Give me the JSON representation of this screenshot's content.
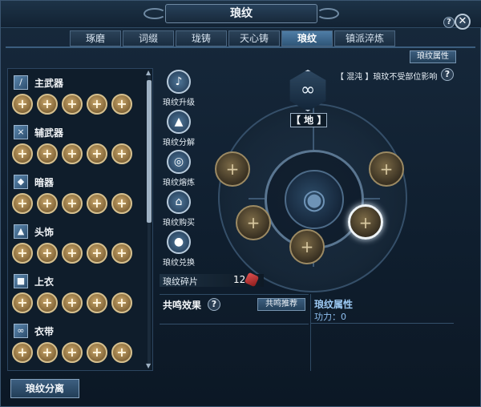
{
  "window": {
    "title": "琅纹"
  },
  "tabs": [
    {
      "label": "琢磨",
      "active": false
    },
    {
      "label": "词缀",
      "active": false
    },
    {
      "label": "珑铸",
      "active": false
    },
    {
      "label": "天心铸",
      "active": false
    },
    {
      "label": "琅纹",
      "active": true
    },
    {
      "label": "镇派淬炼",
      "active": false
    }
  ],
  "header": {
    "attr_button": "琅纹属性",
    "help": "?",
    "close": "✕"
  },
  "slots": [
    {
      "name": "主武器",
      "icon": "sword-icon"
    },
    {
      "name": "辅武器",
      "icon": "crossed-blades-icon"
    },
    {
      "name": "暗器",
      "icon": "dagger-icon"
    },
    {
      "name": "头饰",
      "icon": "helmet-icon"
    },
    {
      "name": "上衣",
      "icon": "robe-icon"
    },
    {
      "name": "衣带",
      "icon": "sash-icon"
    }
  ],
  "plus_symbol": "+",
  "actions": [
    {
      "label": "琅纹升级",
      "icon": "upgrade-icon"
    },
    {
      "label": "琅纹分解",
      "icon": "decompose-icon"
    },
    {
      "label": "琅纹熔炼",
      "icon": "smelt-icon"
    },
    {
      "label": "琅纹购买",
      "icon": "shop-icon"
    },
    {
      "label": "琅纹兑换",
      "icon": "exchange-icon"
    }
  ],
  "dial": {
    "grade": "【 地 】",
    "note": "【 混沌 】琅玟不受部位影响",
    "selected_socket": 5
  },
  "fragments": {
    "label": "琅纹碎片",
    "count": "12"
  },
  "resonance": {
    "title": "共鸣效果",
    "recommend": "共鸣推荐"
  },
  "attributes": {
    "title": "琅纹属性",
    "power": "功力：0"
  },
  "bottom": {
    "split_button": "琅纹分离"
  }
}
